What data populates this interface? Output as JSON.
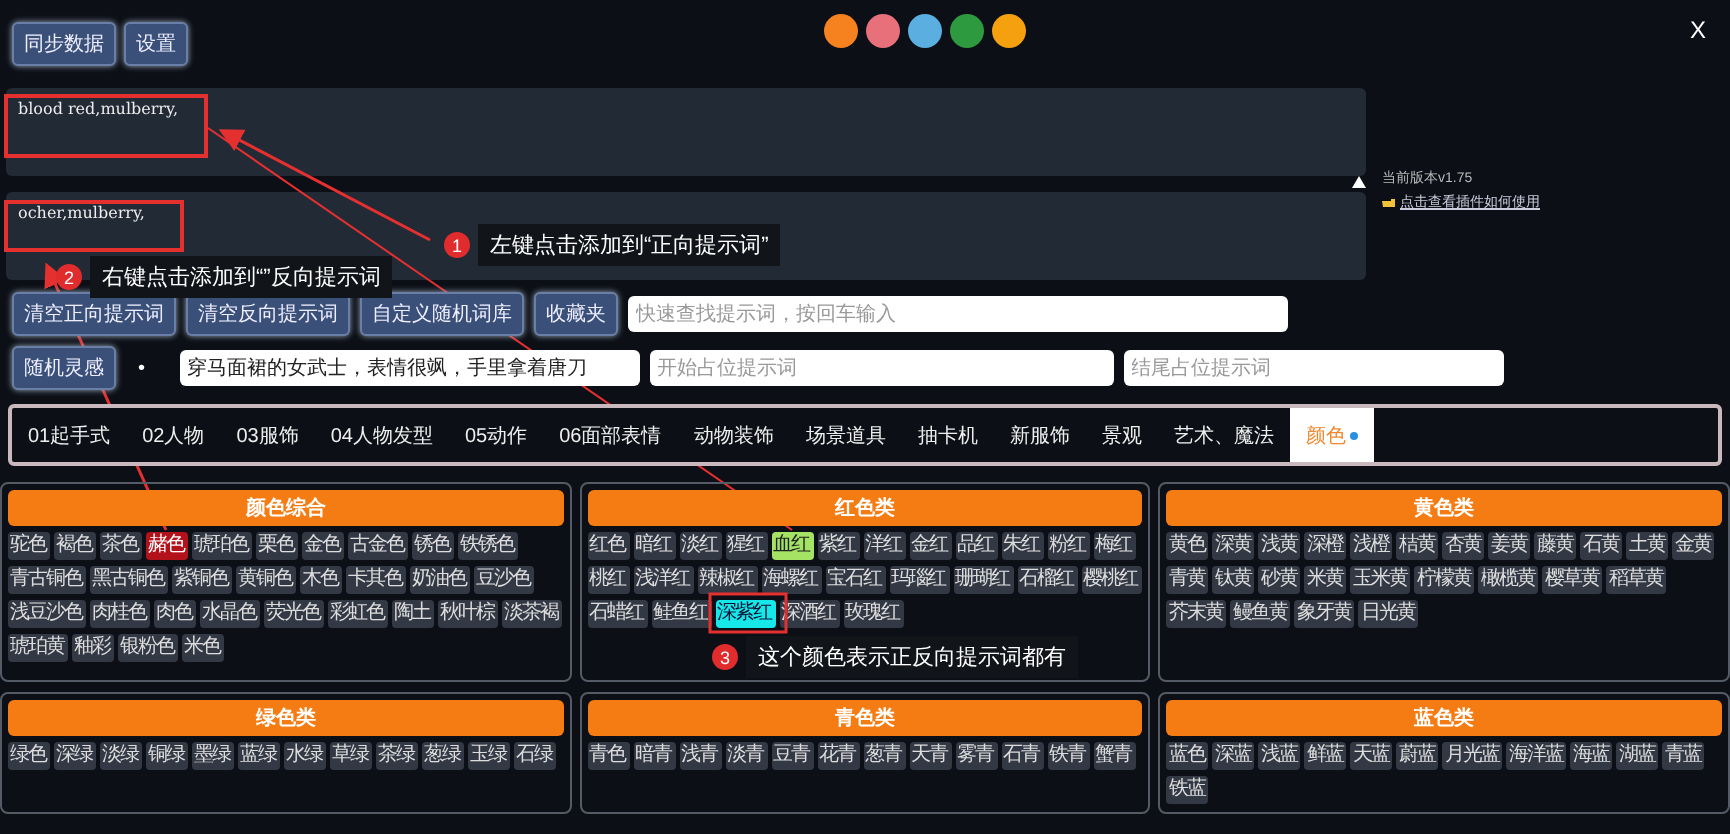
{
  "top_bar": {
    "buttons": [
      "同步数据",
      "设置"
    ],
    "color_dots": [
      {
        "color": "#f5821f"
      },
      {
        "color": "#e8707a"
      },
      {
        "color": "#5aaee0"
      },
      {
        "color": "#2e9a3f"
      },
      {
        "color": "#f5a00f"
      }
    ],
    "close": "X"
  },
  "version": "当前版本v1.75",
  "help_link": "点击查看插件如何使用",
  "positive_prompt": {
    "value": "blood red,mulberry,"
  },
  "negative_prompt": {
    "value": "ocher,mulberry,"
  },
  "action_buttons": [
    "清空正向提示词",
    "清空反向提示词",
    "自定义随机词库",
    "收藏夹"
  ],
  "search": {
    "placeholder": "快速查找提示词，按回车输入"
  },
  "random_button": "随机灵感",
  "bullet": "•",
  "inspiration": {
    "value": "穿马面裙的女武士，表情很飒，手里拿着唐刀"
  },
  "start_field": {
    "placeholder": "开始占位提示词"
  },
  "end_field": {
    "placeholder": "结尾占位提示词"
  },
  "tabs": [
    {
      "label": "01起手式",
      "selected": false
    },
    {
      "label": "02人物",
      "selected": false
    },
    {
      "label": "03服饰",
      "selected": false
    },
    {
      "label": "04人物发型",
      "selected": false
    },
    {
      "label": "05动作",
      "selected": false
    },
    {
      "label": "06面部表情",
      "selected": false
    },
    {
      "label": "动物装饰",
      "selected": false
    },
    {
      "label": "场景道具",
      "selected": false
    },
    {
      "label": "抽卡机",
      "selected": false
    },
    {
      "label": "新服饰",
      "selected": false
    },
    {
      "label": "景观",
      "selected": false
    },
    {
      "label": "艺术、魔法",
      "selected": false
    },
    {
      "label": "颜色",
      "selected": true
    }
  ],
  "panels": [
    {
      "title": "颜色综合",
      "chips": [
        {
          "label": "驼色",
          "positive": false,
          "negative": false
        },
        {
          "label": "褐色",
          "positive": false,
          "negative": false
        },
        {
          "label": "茶色",
          "positive": false,
          "negative": false
        },
        {
          "label": "赭色",
          "positive": false,
          "negative": true
        },
        {
          "label": "琥珀色",
          "positive": false,
          "negative": false
        },
        {
          "label": "栗色",
          "positive": false,
          "negative": false
        },
        {
          "label": "金色",
          "positive": false,
          "negative": false
        },
        {
          "label": "古金色",
          "positive": false,
          "negative": false
        },
        {
          "label": "锈色",
          "positive": false,
          "negative": false
        },
        {
          "label": "铁锈色",
          "positive": false,
          "negative": false
        },
        {
          "label": "青古铜色",
          "positive": false,
          "negative": false
        },
        {
          "label": "黑古铜色",
          "positive": false,
          "negative": false
        },
        {
          "label": "紫铜色",
          "positive": false,
          "negative": false
        },
        {
          "label": "黄铜色",
          "positive": false,
          "negative": false
        },
        {
          "label": "木色",
          "positive": false,
          "negative": false
        },
        {
          "label": "卡其色",
          "positive": false,
          "negative": false
        },
        {
          "label": "奶油色",
          "positive": false,
          "negative": false
        },
        {
          "label": "豆沙色",
          "positive": false,
          "negative": false
        },
        {
          "label": "浅豆沙色",
          "positive": false,
          "negative": false
        },
        {
          "label": "肉桂色",
          "positive": false,
          "negative": false
        },
        {
          "label": "肉色",
          "positive": false,
          "negative": false
        },
        {
          "label": "水晶色",
          "positive": false,
          "negative": false
        },
        {
          "label": "荧光色",
          "positive": false,
          "negative": false
        },
        {
          "label": "彩虹色",
          "positive": false,
          "negative": false
        },
        {
          "label": "陶土",
          "positive": false,
          "negative": false
        },
        {
          "label": "秋叶棕",
          "positive": false,
          "negative": false
        },
        {
          "label": "淡茶褐",
          "positive": false,
          "negative": false
        },
        {
          "label": "琥珀黄",
          "positive": false,
          "negative": false
        },
        {
          "label": "釉彩",
          "positive": false,
          "negative": false
        },
        {
          "label": "银粉色",
          "positive": false,
          "negative": false
        },
        {
          "label": "米色",
          "positive": false,
          "negative": false
        }
      ]
    },
    {
      "title": "红色类",
      "chips": [
        {
          "label": "红色",
          "positive": false,
          "negative": false
        },
        {
          "label": "暗红",
          "positive": false,
          "negative": false
        },
        {
          "label": "淡红",
          "positive": false,
          "negative": false
        },
        {
          "label": "猩红",
          "positive": false,
          "negative": false
        },
        {
          "label": "血红",
          "positive": true,
          "negative": false
        },
        {
          "label": "紫红",
          "positive": false,
          "negative": false
        },
        {
          "label": "洋红",
          "positive": false,
          "negative": false
        },
        {
          "label": "金红",
          "positive": false,
          "negative": false
        },
        {
          "label": "品红",
          "positive": false,
          "negative": false
        },
        {
          "label": "朱红",
          "positive": false,
          "negative": false
        },
        {
          "label": "粉红",
          "positive": false,
          "negative": false
        },
        {
          "label": "梅红",
          "positive": false,
          "negative": false
        },
        {
          "label": "桃红",
          "positive": false,
          "negative": false
        },
        {
          "label": "浅洋红",
          "positive": false,
          "negative": false
        },
        {
          "label": "辣椒红",
          "positive": false,
          "negative": false
        },
        {
          "label": "海螺红",
          "positive": false,
          "negative": false
        },
        {
          "label": "宝石红",
          "positive": false,
          "negative": false
        },
        {
          "label": "玛瑙红",
          "positive": false,
          "negative": false
        },
        {
          "label": "珊瑚红",
          "positive": false,
          "negative": false
        },
        {
          "label": "石榴红",
          "positive": false,
          "negative": false
        },
        {
          "label": "樱桃红",
          "positive": false,
          "negative": false
        },
        {
          "label": "石蜡红",
          "positive": false,
          "negative": false
        },
        {
          "label": "鲑鱼红",
          "positive": false,
          "negative": false
        },
        {
          "label": "深紫红",
          "positive": true,
          "negative": true
        },
        {
          "label": "深酒红",
          "positive": false,
          "negative": false
        },
        {
          "label": "玫瑰红",
          "positive": false,
          "negative": false
        }
      ]
    },
    {
      "title": "黄色类",
      "chips": [
        {
          "label": "黄色",
          "positive": false,
          "negative": false
        },
        {
          "label": "深黄",
          "positive": false,
          "negative": false
        },
        {
          "label": "浅黄",
          "positive": false,
          "negative": false
        },
        {
          "label": "深橙",
          "positive": false,
          "negative": false
        },
        {
          "label": "浅橙",
          "positive": false,
          "negative": false
        },
        {
          "label": "桔黄",
          "positive": false,
          "negative": false
        },
        {
          "label": "杏黄",
          "positive": false,
          "negative": false
        },
        {
          "label": "姜黄",
          "positive": false,
          "negative": false
        },
        {
          "label": "藤黄",
          "positive": false,
          "negative": false
        },
        {
          "label": "石黄",
          "positive": false,
          "negative": false
        },
        {
          "label": "土黄",
          "positive": false,
          "negative": false
        },
        {
          "label": "金黄",
          "positive": false,
          "negative": false
        },
        {
          "label": "青黄",
          "positive": false,
          "negative": false
        },
        {
          "label": "钛黄",
          "positive": false,
          "negative": false
        },
        {
          "label": "砂黄",
          "positive": false,
          "negative": false
        },
        {
          "label": "米黄",
          "positive": false,
          "negative": false
        },
        {
          "label": "玉米黄",
          "positive": false,
          "negative": false
        },
        {
          "label": "柠檬黄",
          "positive": false,
          "negative": false
        },
        {
          "label": "橄榄黄",
          "positive": false,
          "negative": false
        },
        {
          "label": "樱草黄",
          "positive": false,
          "negative": false
        },
        {
          "label": "稻草黄",
          "positive": false,
          "negative": false
        },
        {
          "label": "芥末黄",
          "positive": false,
          "negative": false
        },
        {
          "label": "鳗鱼黄",
          "positive": false,
          "negative": false
        },
        {
          "label": "象牙黄",
          "positive": false,
          "negative": false
        },
        {
          "label": "日光黄",
          "positive": false,
          "negative": false
        }
      ]
    },
    {
      "title": "绿色类",
      "chips": [
        {
          "label": "绿色",
          "positive": false,
          "negative": false
        },
        {
          "label": "深绿",
          "positive": false,
          "negative": false
        },
        {
          "label": "淡绿",
          "positive": false,
          "negative": false
        },
        {
          "label": "铜绿",
          "positive": false,
          "negative": false
        },
        {
          "label": "墨绿",
          "positive": false,
          "negative": false
        },
        {
          "label": "蓝绿",
          "positive": false,
          "negative": false
        },
        {
          "label": "水绿",
          "positive": false,
          "negative": false
        },
        {
          "label": "草绿",
          "positive": false,
          "negative": false
        },
        {
          "label": "茶绿",
          "positive": false,
          "negative": false
        },
        {
          "label": "葱绿",
          "positive": false,
          "negative": false
        },
        {
          "label": "玉绿",
          "positive": false,
          "negative": false
        },
        {
          "label": "石绿",
          "positive": false,
          "negative": false
        }
      ]
    },
    {
      "title": "青色类",
      "chips": [
        {
          "label": "青色",
          "positive": false,
          "negative": false
        },
        {
          "label": "暗青",
          "positive": false,
          "negative": false
        },
        {
          "label": "浅青",
          "positive": false,
          "negative": false
        },
        {
          "label": "淡青",
          "positive": false,
          "negative": false
        },
        {
          "label": "豆青",
          "positive": false,
          "negative": false
        },
        {
          "label": "花青",
          "positive": false,
          "negative": false
        },
        {
          "label": "葱青",
          "positive": false,
          "negative": false
        },
        {
          "label": "天青",
          "positive": false,
          "negative": false
        },
        {
          "label": "雾青",
          "positive": false,
          "negative": false
        },
        {
          "label": "石青",
          "positive": false,
          "negative": false
        },
        {
          "label": "铁青",
          "positive": false,
          "negative": false
        },
        {
          "label": "蟹青",
          "positive": false,
          "negative": false
        }
      ]
    },
    {
      "title": "蓝色类",
      "chips": [
        {
          "label": "蓝色",
          "positive": false,
          "negative": false
        },
        {
          "label": "深蓝",
          "positive": false,
          "negative": false
        },
        {
          "label": "浅蓝",
          "positive": false,
          "negative": false
        },
        {
          "label": "鲜蓝",
          "positive": false,
          "negative": false
        },
        {
          "label": "天蓝",
          "positive": false,
          "negative": false
        },
        {
          "label": "蔚蓝",
          "positive": false,
          "negative": false
        },
        {
          "label": "月光蓝",
          "positive": false,
          "negative": false
        },
        {
          "label": "海洋蓝",
          "positive": false,
          "negative": false
        },
        {
          "label": "海蓝",
          "positive": false,
          "negative": false
        },
        {
          "label": "湖蓝",
          "positive": false,
          "negative": false
        },
        {
          "label": "青蓝",
          "positive": false,
          "negative": false
        },
        {
          "label": "铁蓝",
          "positive": false,
          "negative": false
        }
      ]
    }
  ],
  "annotations": [
    {
      "number": "1",
      "text": "左键点击添加到“正向提示词”"
    },
    {
      "number": "2",
      "text": "右键点击添加到“”反向提示词"
    },
    {
      "number": "3",
      "text": "这个颜色表示正反向提示词都有"
    }
  ]
}
